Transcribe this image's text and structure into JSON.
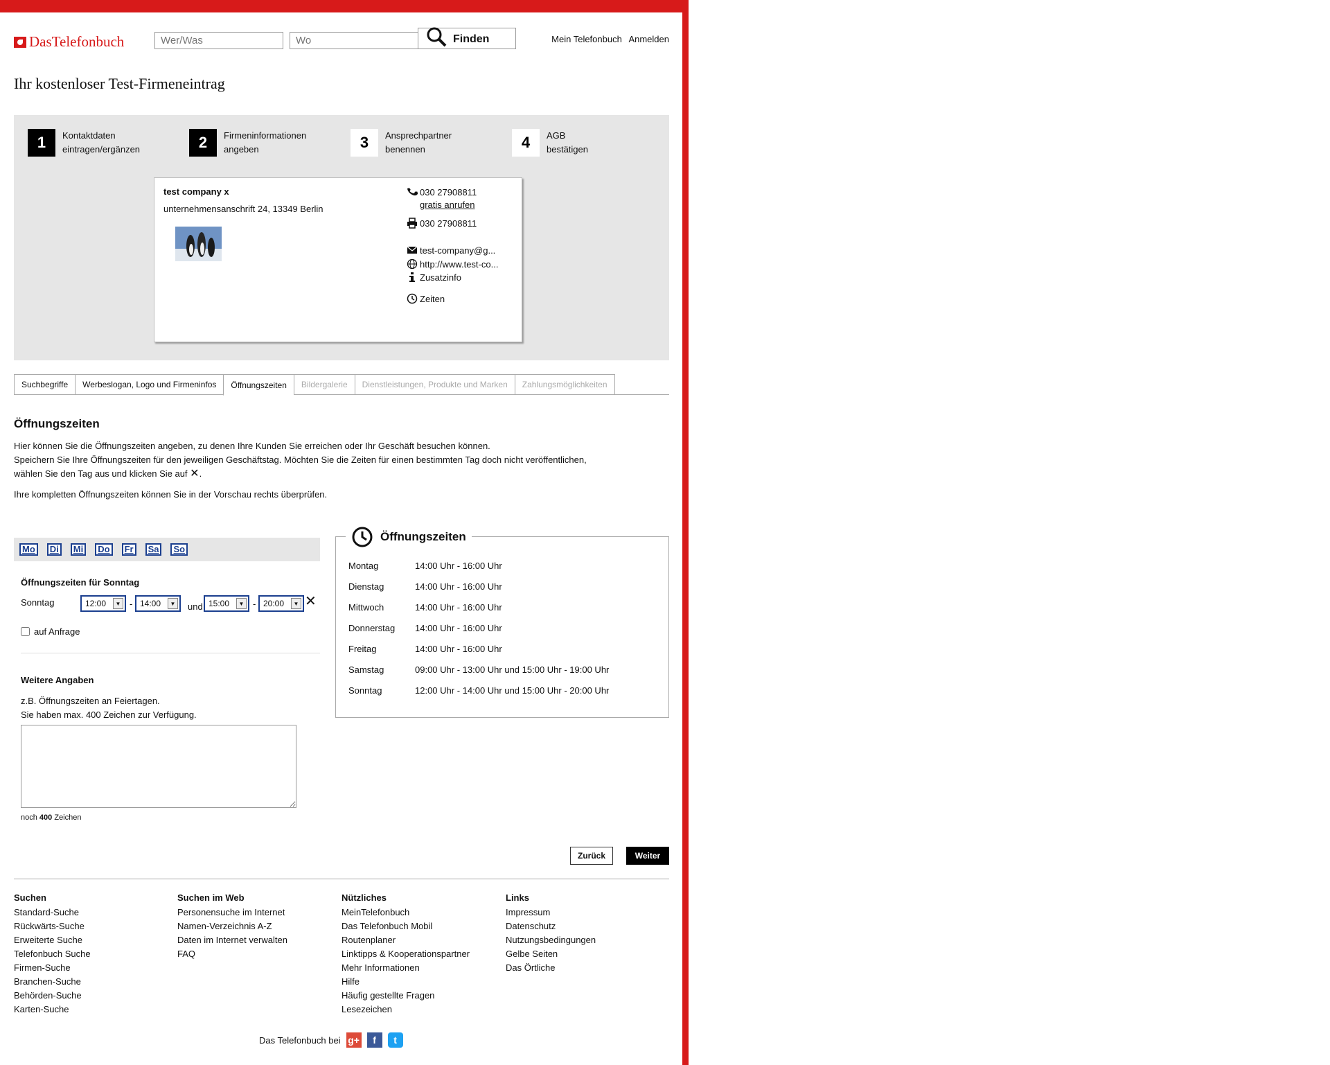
{
  "colors": {
    "brand_red": "#d71a1a",
    "wizard_bg": "#e6e6e6",
    "day_border": "#1b3f8f"
  },
  "header": {
    "logo_text": "DasTelefonbuch",
    "search_who_placeholder": "Wer/Was",
    "search_where_placeholder": "Wo",
    "find_label": "Finden",
    "links": [
      "Mein Telefonbuch",
      "Anmelden"
    ]
  },
  "page_title": "Ihr kostenloser Test-Firmeneintrag",
  "steps": [
    {
      "number": "1",
      "line1": "Kontaktdaten",
      "line2": "eintragen/ergänzen",
      "done": true
    },
    {
      "number": "2",
      "line1": "Firmeninformationen",
      "line2": "angeben",
      "done": true
    },
    {
      "number": "3",
      "line1": "Ansprechpartner",
      "line2": "benennen",
      "done": false
    },
    {
      "number": "4",
      "line1": "AGB",
      "line2": "bestätigen",
      "done": false
    }
  ],
  "card": {
    "company": "test company x",
    "address": "unternehmensanschrift 24, 13349 Berlin",
    "phone": "030 27908811",
    "call_free": "gratis anrufen",
    "fax": "030 27908811",
    "email": "test-company@g...",
    "website": "http://www.test-co...",
    "extra": "Zusatzinfo",
    "hours": "Zeiten"
  },
  "tabs": [
    {
      "label": "Suchbegriffe",
      "state": "normal"
    },
    {
      "label": "Werbeslogan, Logo und Firmeninfos",
      "state": "normal"
    },
    {
      "label": "Öffnungszeiten",
      "state": "active"
    },
    {
      "label": "Bildergalerie",
      "state": "disabled"
    },
    {
      "label": "Dienstleistungen, Produkte und Marken",
      "state": "disabled"
    },
    {
      "label": "Zahlungsmöglichkeiten",
      "state": "disabled"
    }
  ],
  "section": {
    "title": "Öffnungszeiten",
    "intro1": "Hier können Sie die Öffnungszeiten angeben, zu denen Ihre Kunden Sie erreichen oder Ihr Geschäft besuchen können.",
    "intro2": "Speichern Sie Ihre Öffnungszeiten für den jeweiligen Geschäftstag. Möchten Sie die Zeiten für einen bestimmten Tag doch nicht veröffentlichen,",
    "intro3": "wählen Sie den Tag aus und klicken Sie auf",
    "intro3_end": ".",
    "intro4": "Ihre kompletten Öffnungszeiten können Sie in der Vorschau rechts überprüfen."
  },
  "days": [
    "Mo",
    "Di",
    "Mi",
    "Do",
    "Fr",
    "Sa",
    "So"
  ],
  "editor": {
    "heading": "Öffnungszeiten für Sonntag",
    "day": "Sonntag",
    "from1": "12:00",
    "to1": "14:00",
    "and": "und",
    "from2": "15:00",
    "to2": "20:00",
    "dash": "-",
    "on_request": "auf Anfrage",
    "more_heading": "Weitere Angaben",
    "more_hint1": "z.B. Öffnungszeiten an Feiertagen.",
    "more_hint2": "Sie haben max. 400 Zeichen zur Verfügung.",
    "more_value": "",
    "remaining_prefix": "noch",
    "remaining_count": "400",
    "remaining_suffix": "Zeichen"
  },
  "preview": {
    "title": "Öffnungszeiten",
    "rows": [
      {
        "day": "Montag",
        "hours": "14:00 Uhr - 16:00 Uhr"
      },
      {
        "day": "Dienstag",
        "hours": "14:00 Uhr - 16:00 Uhr"
      },
      {
        "day": "Mittwoch",
        "hours": "14:00 Uhr - 16:00 Uhr"
      },
      {
        "day": "Donnerstag",
        "hours": "14:00 Uhr - 16:00 Uhr"
      },
      {
        "day": "Freitag",
        "hours": "14:00 Uhr - 16:00 Uhr"
      },
      {
        "day": "Samstag",
        "hours": "09:00 Uhr - 13:00 Uhr und 15:00 Uhr - 19:00 Uhr"
      },
      {
        "day": "Sonntag",
        "hours": "12:00 Uhr - 14:00 Uhr und 15:00 Uhr - 20:00 Uhr"
      }
    ]
  },
  "buttons": {
    "back": "Zurück",
    "next": "Weiter"
  },
  "footer": {
    "columns": [
      {
        "title": "Suchen",
        "links": [
          "Standard-Suche",
          "Rückwärts-Suche",
          "Erweiterte Suche",
          "Telefonbuch Suche",
          "Firmen-Suche",
          "Branchen-Suche",
          "Behörden-Suche",
          "Karten-Suche"
        ]
      },
      {
        "title": "Suchen im Web",
        "links": [
          "Personensuche im Internet",
          "Namen-Verzeichnis A-Z",
          "Daten im Internet verwalten",
          "FAQ"
        ]
      },
      {
        "title": "Nützliches",
        "links": [
          "MeinTelefonbuch",
          "Das Telefonbuch Mobil",
          "Routenplaner",
          "Linktipps & Kooperationspartner",
          "Mehr Informationen",
          "Hilfe",
          "Häufig gestellte Fragen",
          "Lesezeichen"
        ]
      },
      {
        "title": "Links",
        "links": [
          "Impressum",
          "Datenschutz",
          "Nutzungsbedingungen",
          "Gelbe Seiten",
          "Das Örtliche"
        ]
      }
    ],
    "social_text": "Das Telefonbuch bei",
    "social_icons": [
      "google-plus-icon",
      "facebook-icon",
      "twitter-icon"
    ]
  }
}
